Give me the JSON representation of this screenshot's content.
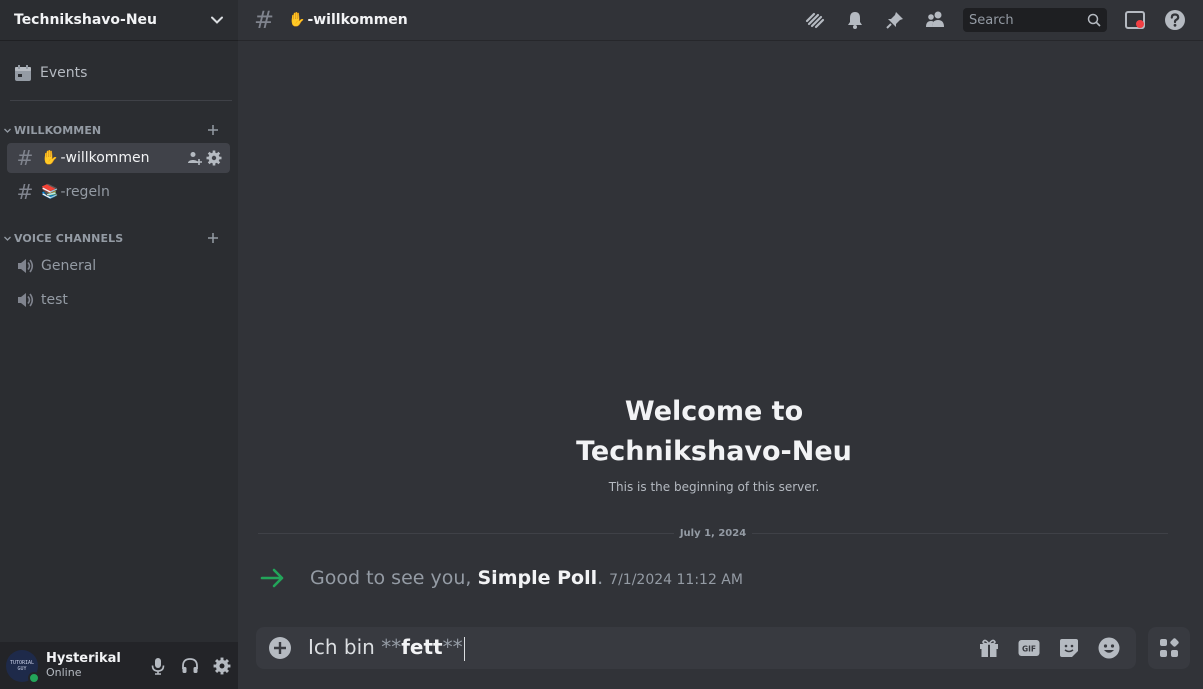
{
  "server": {
    "name": "Technikshavo-Neu"
  },
  "sidebar": {
    "events_label": "Events",
    "categories": [
      {
        "label": "WILLKOMMEN"
      },
      {
        "label": "VOICE CHANNELS"
      }
    ],
    "text_channels": [
      {
        "emoji": "✋",
        "name": "-willkommen",
        "active": true
      },
      {
        "emoji": "📚",
        "name": "-regeln",
        "active": false
      }
    ],
    "voice_channels": [
      {
        "name": "General"
      },
      {
        "name": "test"
      }
    ]
  },
  "user": {
    "name": "Hysterikal",
    "status": "Online",
    "avatar_text": "TUTORIAL GUY",
    "status_color": "#23a55a"
  },
  "channel": {
    "emoji": "✋",
    "name": "-willkommen"
  },
  "search": {
    "placeholder": "Search"
  },
  "welcome": {
    "line1": "Welcome to",
    "line2": "Technikshavo-Neu",
    "subtitle": "This is the beginning of this server."
  },
  "messages": {
    "date": "July 1, 2024",
    "system": {
      "prefix": "Good to see you, ",
      "user": "Simple Poll",
      "suffix": ".",
      "timestamp": "7/1/2024 11:12 AM"
    }
  },
  "composer": {
    "text_prefix": "Ich bin ",
    "md_open": "**",
    "bold_text": "fett",
    "md_close": "**"
  },
  "icons": {
    "topbar": [
      "threads-icon",
      "bell-icon",
      "pin-icon",
      "members-icon",
      "inbox-icon",
      "help-icon"
    ],
    "composer": [
      "gift-icon",
      "gif-icon",
      "sticker-icon",
      "emoji-icon",
      "apps-icon"
    ]
  },
  "colors": {
    "accent_green": "#23a55a",
    "background": "#313338",
    "sidebar": "#2b2d31"
  }
}
